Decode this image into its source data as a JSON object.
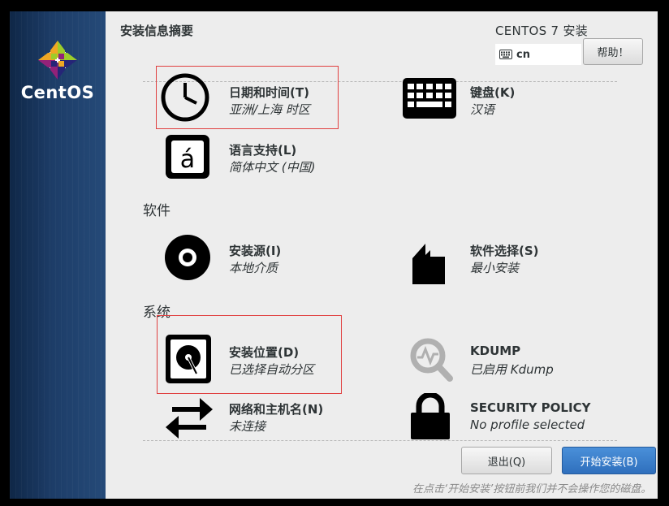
{
  "sidebar": {
    "brand": "CentOS"
  },
  "header": {
    "title": "安装信息摘要",
    "product": "CENTOS 7 安装",
    "keyboard_layout": "cn",
    "help_label": "帮助！"
  },
  "sections": {
    "localization": {
      "label": ""
    },
    "software": {
      "label": "软件"
    },
    "system": {
      "label": "系统"
    }
  },
  "spokes": {
    "datetime": {
      "title": "日期和时间(T)",
      "status": "亚洲/上海 时区",
      "icon": "clock-icon"
    },
    "keyboard": {
      "title": "键盘(K)",
      "status": "汉语",
      "icon": "keyboard-icon"
    },
    "language": {
      "title": "语言支持(L)",
      "status": "简体中文 (中国)",
      "icon": "language-icon"
    },
    "source": {
      "title": "安装源(I)",
      "status": "本地介质",
      "icon": "disc-icon"
    },
    "software_selection": {
      "title": "软件选择(S)",
      "status": "最小安装",
      "icon": "package-icon"
    },
    "destination": {
      "title": "安装位置(D)",
      "status": "已选择自动分区",
      "icon": "harddisk-icon"
    },
    "kdump": {
      "title": "KDUMP",
      "status": "已启用 Kdump",
      "icon": "search-icon"
    },
    "network": {
      "title": "网络和主机名(N)",
      "status": "未连接",
      "icon": "network-arrows-icon"
    },
    "security": {
      "title": "SECURITY POLICY",
      "status": "No profile selected",
      "icon": "lock-icon"
    }
  },
  "footer": {
    "quit_label": "退出(Q)",
    "begin_label": "开始安装(B)",
    "note": "在点击‘开始安装’按钮前我们并不会操作您的磁盘。"
  },
  "colors": {
    "highlight_border": "#e04040",
    "primary_button": "#3b7fcb",
    "sidebar_bg": "#1d3d68"
  }
}
